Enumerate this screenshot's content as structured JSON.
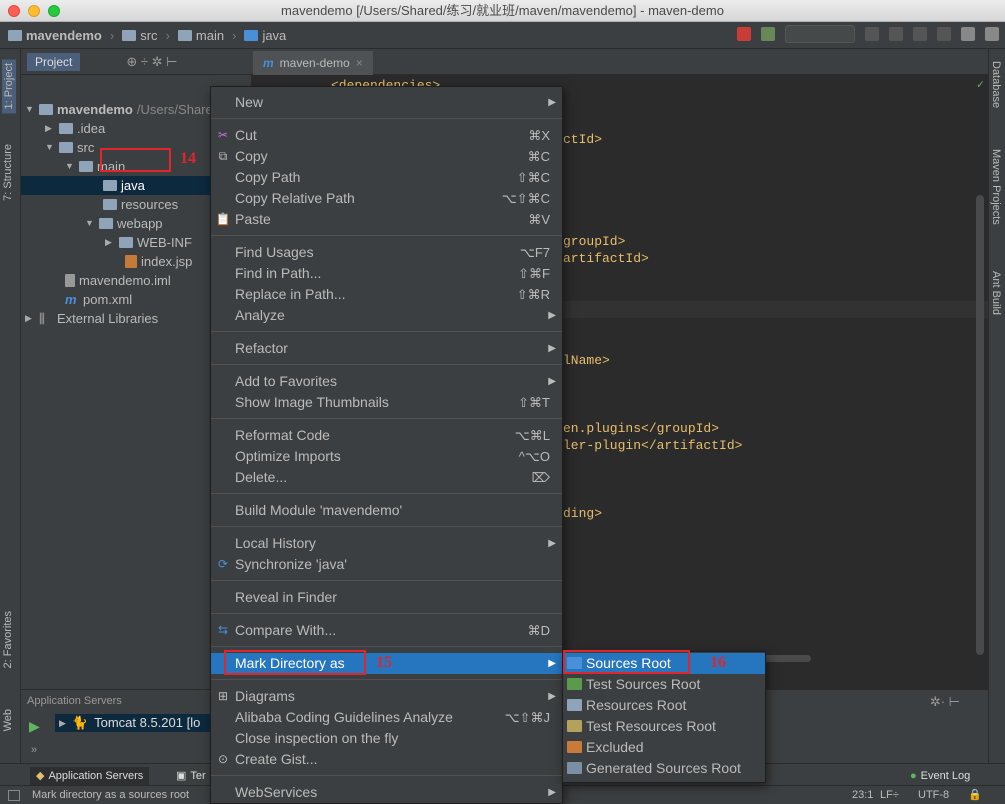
{
  "window": {
    "title": "mavendemo [/Users/Shared/练习/就业班/maven/mavendemo] - maven-demo"
  },
  "navbar": {
    "crumbs": [
      "mavendemo",
      "src",
      "main",
      "java"
    ]
  },
  "left_tool_tabs": {
    "project": "1: Project",
    "structure": "7: Structure",
    "favorites": "2: Favorites",
    "web": "Web"
  },
  "right_tool_tabs": {
    "database": "Database",
    "maven": "Maven Projects",
    "ant": "Ant Build"
  },
  "project_panel": {
    "header": "Project",
    "tree": [
      {
        "label": "mavendemo",
        "extra": "/Users/Shared/练"
      },
      {
        "label": ".idea"
      },
      {
        "label": "src"
      },
      {
        "label": "main"
      },
      {
        "label": "java"
      },
      {
        "label": "resources"
      },
      {
        "label": "webapp"
      },
      {
        "label": "WEB-INF"
      },
      {
        "label": "index.jsp"
      },
      {
        "label": "mavendemo.iml"
      },
      {
        "label": "pom.xml"
      },
      {
        "label": "External Libraries"
      }
    ]
  },
  "editor": {
    "tab": "maven-demo",
    "lines": [
      {
        "text": "<dependencies>"
      },
      {
        "text": "ctId>"
      },
      {
        "text": "groupId>"
      },
      {
        "text": "artifactId>"
      },
      {
        "text": "lName>"
      },
      {
        "text": "en.plugins</groupId>"
      },
      {
        "text": "ler-plugin</artifactId>"
      },
      {
        "text": "ding>"
      }
    ]
  },
  "bottom_panel": {
    "header": "Application Servers",
    "server": "Tomcat 8.5.201 [lo"
  },
  "tool_window_bar": {
    "app_servers": "Application Servers",
    "terminal": "Ter",
    "event_log": "Event Log"
  },
  "status_bar": {
    "message": "Mark directory as a sources root",
    "position": "23:1",
    "line_sep": "LF÷",
    "encoding": "UTF-8"
  },
  "context_menu": {
    "new": "New",
    "cut": "Cut",
    "cut_sc": "⌘X",
    "copy": "Copy",
    "copy_sc": "⌘C",
    "copy_path": "Copy Path",
    "copy_path_sc": "⇧⌘C",
    "copy_rel": "Copy Relative Path",
    "copy_rel_sc": "⌥⇧⌘C",
    "paste": "Paste",
    "paste_sc": "⌘V",
    "find_usages": "Find Usages",
    "find_usages_sc": "⌥F7",
    "find_in_path": "Find in Path...",
    "find_in_path_sc": "⇧⌘F",
    "replace_in_path": "Replace in Path...",
    "replace_in_path_sc": "⇧⌘R",
    "analyze": "Analyze",
    "refactor": "Refactor",
    "add_fav": "Add to Favorites",
    "show_thumb": "Show Image Thumbnails",
    "show_thumb_sc": "⇧⌘T",
    "reformat": "Reformat Code",
    "reformat_sc": "⌥⌘L",
    "optimize": "Optimize Imports",
    "optimize_sc": "^⌥O",
    "delete": "Delete...",
    "delete_sc": "⌦",
    "build_module": "Build Module 'mavendemo'",
    "local_history": "Local History",
    "synchronize": "Synchronize 'java'",
    "reveal": "Reveal in Finder",
    "compare": "Compare With...",
    "compare_sc": "⌘D",
    "mark_dir": "Mark Directory as",
    "diagrams": "Diagrams",
    "alibaba": "Alibaba Coding Guidelines Analyze",
    "alibaba_sc": "⌥⇧⌘J",
    "close_insp": "Close inspection on the fly",
    "create_gist": "Create Gist...",
    "webservices": "WebServices"
  },
  "submenu": {
    "sources_root": "Sources Root",
    "test_sources_root": "Test Sources Root",
    "resources_root": "Resources Root",
    "test_resources_root": "Test Resources Root",
    "excluded": "Excluded",
    "generated_sources_root": "Generated Sources Root"
  },
  "annotations": {
    "a14": "14",
    "a15": "15",
    "a16": "16"
  },
  "colors": {
    "highlight": "#2675bf",
    "annotation": "#e0262a"
  }
}
